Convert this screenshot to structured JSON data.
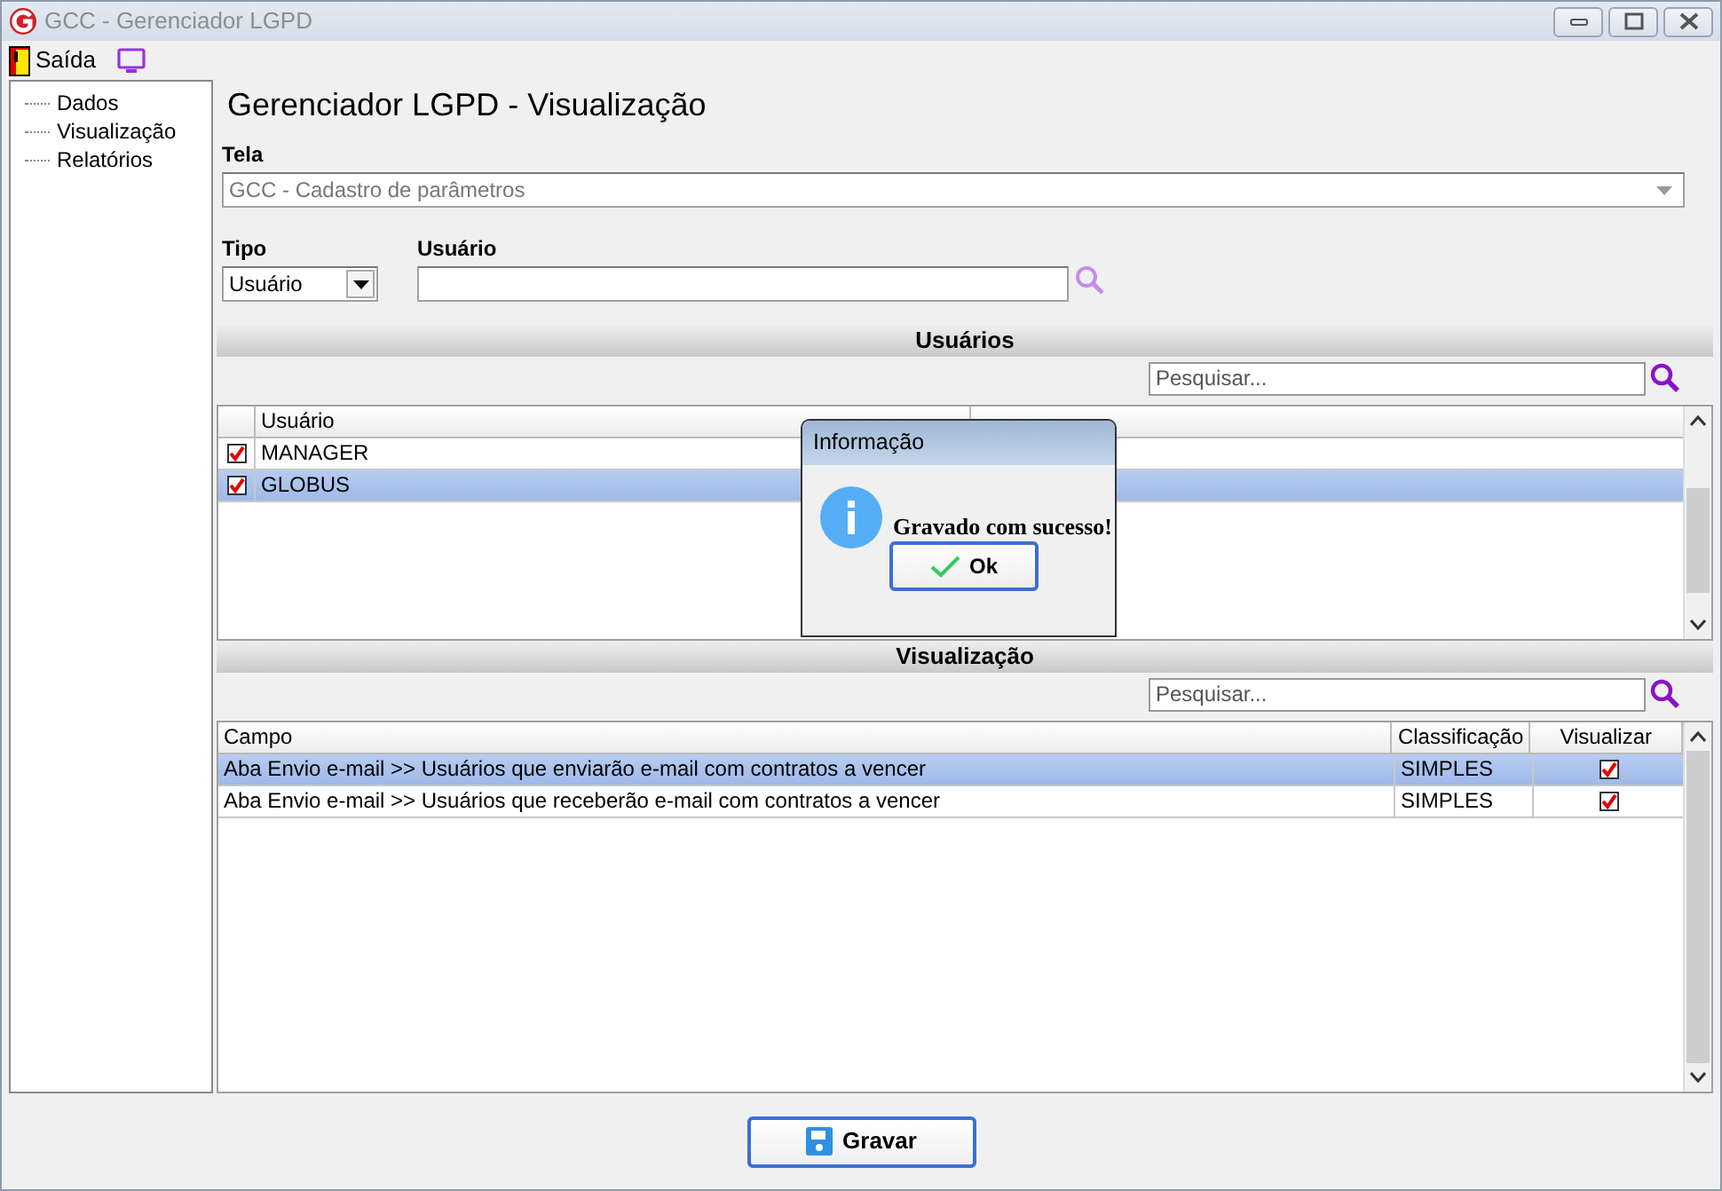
{
  "window": {
    "title": "GCC - Gerenciador LGPD"
  },
  "toolbar": {
    "exit_label": "Saída"
  },
  "tree": [
    {
      "label": "Dados"
    },
    {
      "label": "Visualização"
    },
    {
      "label": "Relatórios"
    }
  ],
  "heading": "Gerenciador LGPD - Visualização",
  "tela": {
    "label": "Tela",
    "value": "GCC - Cadastro de parâmetros",
    "disabled": true
  },
  "tipo": {
    "label": "Tipo",
    "value": "Usuário"
  },
  "usuario": {
    "label": "Usuário"
  },
  "users_section": {
    "title": "Usuários",
    "search_placeholder": "Pesquisar...",
    "columns": [
      "Usuário"
    ],
    "rows": [
      {
        "usuario": "MANAGER",
        "checked": true,
        "selected": false
      },
      {
        "usuario": "GLOBUS",
        "checked": true,
        "selected": true
      }
    ]
  },
  "view_section": {
    "title": "Visualização",
    "search_placeholder": "Pesquisar...",
    "columns": [
      "Campo",
      "Classificação",
      "Visualizar"
    ],
    "rows": [
      {
        "campo": "Aba Envio e-mail >> Usuários que enviarão e-mail com contratos a vencer",
        "classificacao": "SIMPLES",
        "visualizar": true,
        "selected": true
      },
      {
        "campo": "Aba Envio e-mail >> Usuários que receberão e-mail com contratos a vencer",
        "classificacao": "SIMPLES",
        "visualizar": true,
        "selected": false
      }
    ]
  },
  "dialog": {
    "title": "Informação",
    "message": "Gravado com sucesso!",
    "button": "Ok"
  },
  "save_button": "Gravar"
}
